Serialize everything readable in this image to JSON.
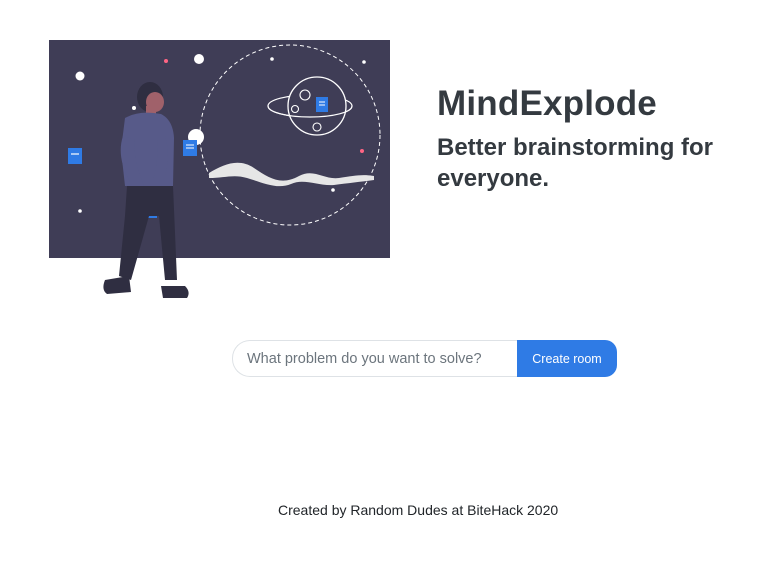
{
  "hero": {
    "illustration_name": "brainstorm-illustration",
    "title": "MindExplode",
    "tagline": "Better brainstorming for everyone."
  },
  "room_form": {
    "placeholder": "What problem do you want to solve?",
    "value": "",
    "button_label": "Create room"
  },
  "footer": {
    "text": "Created by Random Dudes at BiteHack 2020"
  },
  "colors": {
    "illustration_bg": "#3f3d56",
    "accent": "#2f7be5",
    "heading": "#343a40",
    "pink_dot": "#ff6584",
    "sticky_note": "#2f7be5"
  }
}
